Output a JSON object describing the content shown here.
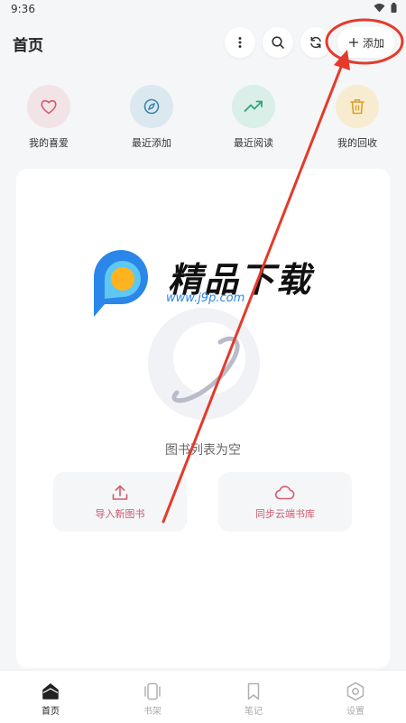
{
  "status": {
    "time": "9:36"
  },
  "header": {
    "title": "首页",
    "add_label": "添加"
  },
  "quick": [
    {
      "label": "我的喜爱",
      "color": "#f2e3e7",
      "icon": "heart-icon"
    },
    {
      "label": "最近添加",
      "color": "#dbe8f0",
      "icon": "compass-icon"
    },
    {
      "label": "最近阅读",
      "color": "#d9efe8",
      "icon": "trend-up-icon"
    },
    {
      "label": "我的回收",
      "color": "#f7ecd0",
      "icon": "trash-icon"
    }
  ],
  "watermark": {
    "title": "精品下载",
    "url": "www.j9p.com"
  },
  "empty": {
    "text": "图书列表为空",
    "import_label": "导入新图书",
    "sync_label": "同步云端书库"
  },
  "nav": [
    {
      "label": "首页",
      "active": true
    },
    {
      "label": "书架",
      "active": false
    },
    {
      "label": "笔记",
      "active": false
    },
    {
      "label": "设置",
      "active": false
    }
  ],
  "colors": {
    "accent": "#d05a6e",
    "annotation": "#e53a2a"
  }
}
